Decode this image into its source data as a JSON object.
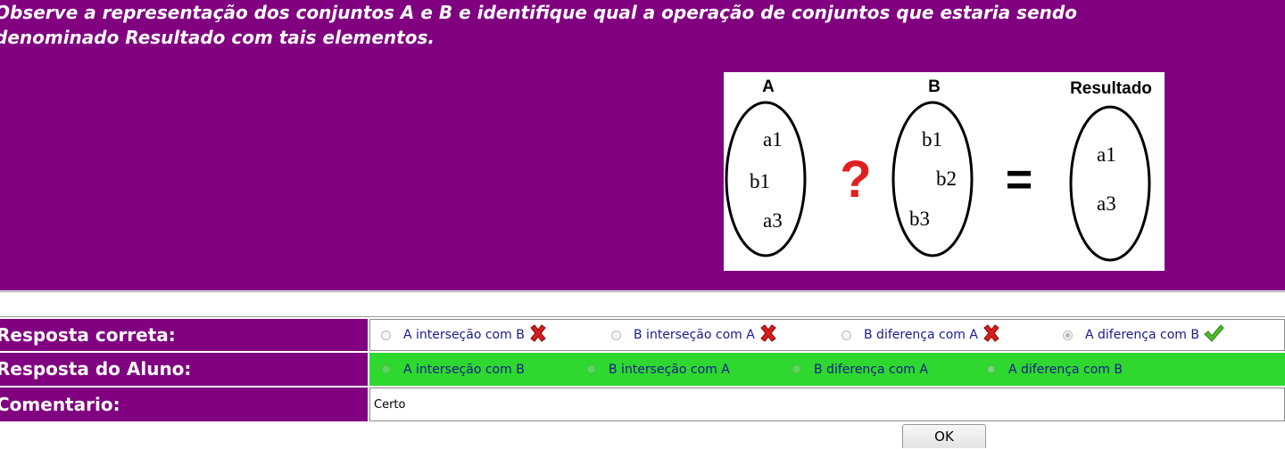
{
  "question": {
    "text": "Observe a representação dos conjuntos A e B e identifique qual a operação de conjuntos que estaria sendo\ndenominado Resultado com tais elementos."
  },
  "figure": {
    "set_a": {
      "label": "A",
      "elements": [
        "a1",
        "b1",
        "a3"
      ]
    },
    "operator": "?",
    "set_b": {
      "label": "B",
      "elements": [
        "b1",
        "b2",
        "b3"
      ]
    },
    "equals": "=",
    "result": {
      "label": "Resultado",
      "elements": [
        "a1",
        "a3"
      ]
    }
  },
  "answers": {
    "correct_label": "Resposta correta:",
    "student_label": "Resposta do Aluno:",
    "comment_label": "Comentario:",
    "options": [
      {
        "label": "A interseção com B",
        "correct": false,
        "icon": "red-x-icon"
      },
      {
        "label": "B interseção com A",
        "correct": false,
        "icon": "red-x-icon"
      },
      {
        "label": "B diferença com A",
        "correct": false,
        "icon": "red-x-icon"
      },
      {
        "label": "A diferença com B",
        "correct": true,
        "icon": "green-check-icon"
      }
    ],
    "selected_index": 3,
    "comment": "Certo"
  },
  "colors": {
    "purple": "#800080",
    "green_row": "#2ed82e",
    "option_text_blue": "#1a1a8c",
    "question_mark_red": "#e02020"
  },
  "ok_button": {
    "label": "OK"
  }
}
